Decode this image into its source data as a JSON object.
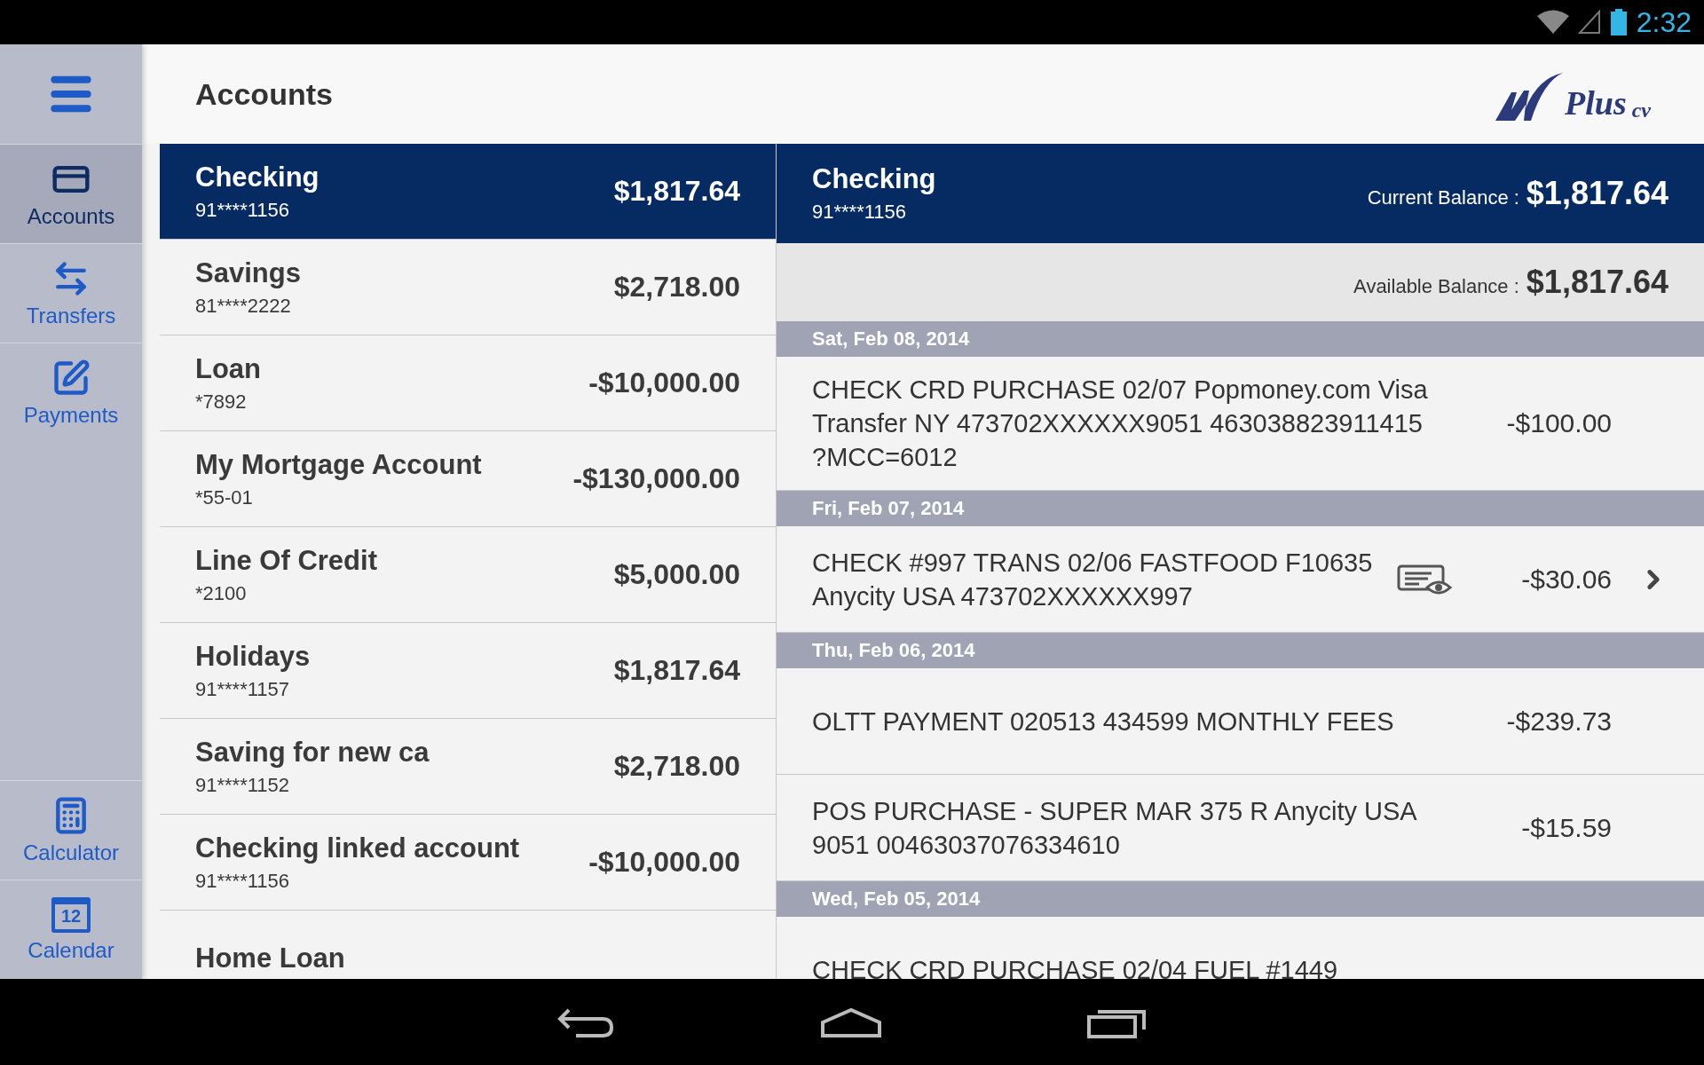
{
  "status_bar": {
    "time": "2:32"
  },
  "sidebar": {
    "top_items": [
      {
        "label": "Accounts",
        "kind": "card",
        "selected": true
      },
      {
        "label": "Transfers",
        "kind": "transfer",
        "selected": false
      },
      {
        "label": "Payments",
        "kind": "check",
        "selected": false
      }
    ],
    "bottom_items": [
      {
        "label": "Calculator",
        "kind": "calculator",
        "selected": false
      },
      {
        "label": "Calendar",
        "kind": "calendar",
        "icon_text": "12",
        "selected": false
      }
    ]
  },
  "header": {
    "title": "Accounts",
    "logo": {
      "word": "Plus",
      "suffix": "cv"
    }
  },
  "accounts": [
    {
      "name": "Checking",
      "number": "91****1156",
      "amount": "$1,817.64",
      "selected": true
    },
    {
      "name": "Savings",
      "number": "81****2222",
      "amount": "$2,718.00",
      "selected": false
    },
    {
      "name": "Loan",
      "number": "*7892",
      "amount": "-$10,000.00",
      "selected": false
    },
    {
      "name": "My Mortgage Account",
      "number": "*55-01",
      "amount": "-$130,000.00",
      "selected": false
    },
    {
      "name": "Line Of Credit",
      "number": "*2100",
      "amount": "$5,000.00",
      "selected": false
    },
    {
      "name": "Holidays",
      "number": "91****1157",
      "amount": "$1,817.64",
      "selected": false
    },
    {
      "name": "Saving for new ca",
      "number": "91****1152",
      "amount": "$2,718.00",
      "selected": false
    },
    {
      "name": "Checking linked account",
      "number": "91****1156",
      "amount": "-$10,000.00",
      "selected": false
    },
    {
      "name": "Home Loan",
      "selected": false
    }
  ],
  "detail": {
    "name": "Checking",
    "number": "91****1156",
    "current_balance_label": "Current Balance :",
    "current_balance": "$1,817.64",
    "available_balance_label": "Available Balance :",
    "available_balance": "$1,817.64",
    "groups": [
      {
        "date": "Sat, Feb 08, 2014",
        "transactions": [
          {
            "description": "CHECK CRD PURCHASE 02/07 Popmoney.com Visa Transfer NY 473702XXXXXX9051 463038823911415 ?MCC=6012",
            "amount": "-$100.00",
            "check_image": false,
            "details": false
          }
        ]
      },
      {
        "date": "Fri, Feb 07, 2014",
        "transactions": [
          {
            "description": "CHECK #997 TRANS 02/06 FASTFOOD F10635 Anycity USA 473702XXXXXX997",
            "amount": "-$30.06",
            "check_image": true,
            "details": true
          }
        ]
      },
      {
        "date": "Thu, Feb 06, 2014",
        "transactions": [
          {
            "description": "OLTT PAYMENT 020513 434599 MONTHLY FEES",
            "amount": "-$239.73",
            "check_image": false,
            "details": false
          },
          {
            "description": "POS PURCHASE - SUPER MAR 375 R Anycity USA 9051 00463037076334610",
            "amount": "-$15.59",
            "check_image": false,
            "details": false
          }
        ]
      },
      {
        "date": "Wed, Feb 05, 2014",
        "transactions": [
          {
            "description": "CHECK CRD PURCHASE 02/04 FUEL #1449",
            "check_image": false,
            "details": false
          }
        ]
      }
    ]
  }
}
